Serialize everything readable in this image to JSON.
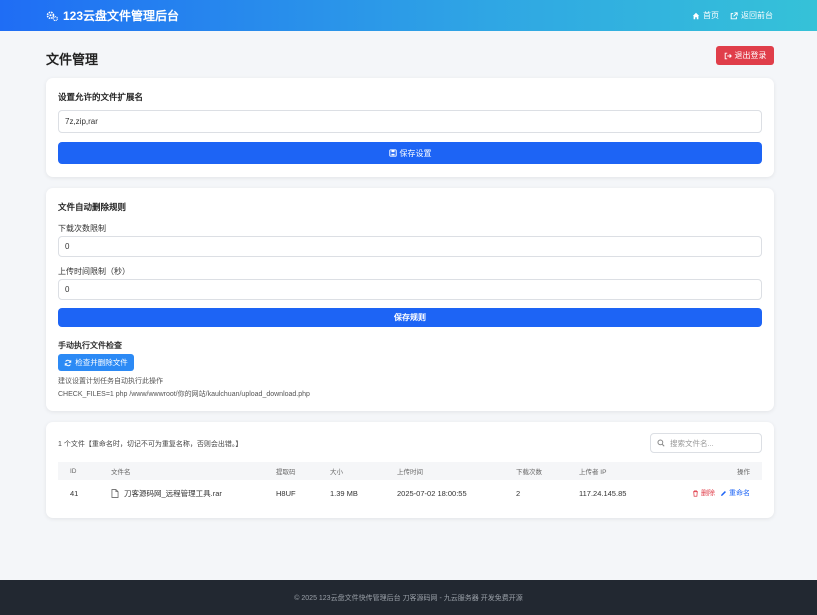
{
  "nav": {
    "brand": "123云盘文件管理后台",
    "links": [
      {
        "label": "首页",
        "icon": "home-icon"
      },
      {
        "label": "返回前台",
        "icon": "external-link-icon"
      }
    ]
  },
  "page": {
    "title": "文件管理",
    "logout_label": "退出登录"
  },
  "extensions_card": {
    "title": "设置允许的文件扩展名",
    "input_value": "7z,zip,rar",
    "save_label": "保存设置"
  },
  "rules_card": {
    "title": "文件自动删除规则",
    "download_limit_label": "下载次数限制",
    "download_limit_value": "0",
    "time_limit_label": "上传时间限制（秒）",
    "time_limit_value": "0",
    "save_label": "保存规则",
    "manual_label": "手动执行文件检查",
    "check_button_label": "检查并删除文件",
    "hint_line1": "建议设置计划任务自动执行此操作",
    "hint_line2": "CHECK_FILES=1 php /www/wwwroot/你的网站/kaulchuan/upload_download.php"
  },
  "files_card": {
    "count_text": "1 个文件【重命名时，切记不可为重复名称，否则会出错。】",
    "search_placeholder": "搜索文件名...",
    "columns": [
      "ID",
      "文件名",
      "提取码",
      "大小",
      "上传时间",
      "下载次数",
      "上传者 IP",
      "操作"
    ],
    "rows": [
      {
        "id": "41",
        "filename": "刀客源码网_远程管理工具.rar",
        "code": "H8UF",
        "size": "1.39 MB",
        "upload_time": "2025-07-02 18:00:55",
        "downloads": "2",
        "ip": "117.24.145.85",
        "delete_label": "删除",
        "rename_label": "重命名"
      }
    ]
  },
  "footer": {
    "text": "© 2025 123云盘文件快传管理后台  刀客源码网 - 九云服务器 开发免费开源"
  },
  "colors": {
    "primary": "#1d64f5",
    "danger": "#e03e4a",
    "footer_bg": "#222831"
  }
}
